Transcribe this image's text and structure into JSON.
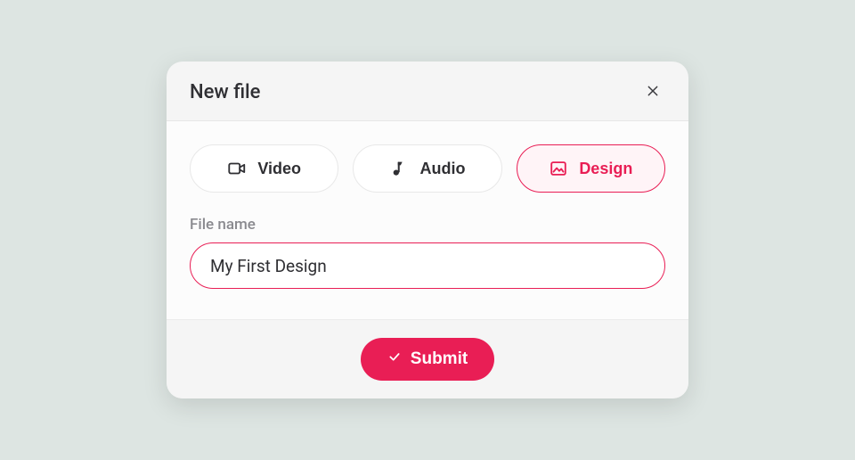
{
  "modal": {
    "title": "New file",
    "types": [
      {
        "key": "video",
        "label": "Video",
        "icon": "video-icon",
        "selected": false
      },
      {
        "key": "audio",
        "label": "Audio",
        "icon": "music-icon",
        "selected": false
      },
      {
        "key": "design",
        "label": "Design",
        "icon": "image-icon",
        "selected": true
      }
    ],
    "filename_label": "File name",
    "filename_value": "My First Design",
    "submit_label": "Submit"
  },
  "colors": {
    "accent": "#e91e55",
    "page_bg": "#dde5e2",
    "modal_bg": "#f5f5f5",
    "body_bg": "#fcfcfc"
  }
}
